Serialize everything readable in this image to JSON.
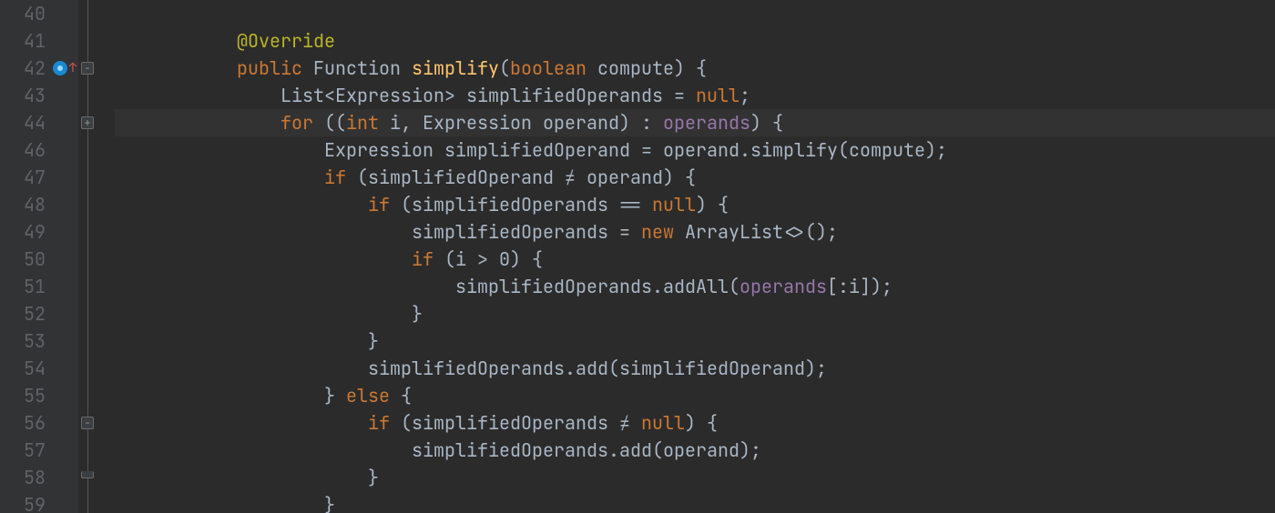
{
  "colors": {
    "background": "#2b2b2b",
    "gutter": "#313335",
    "lineNumber": "#606366",
    "foreground": "#a9b7c6",
    "annotation": "#bbb529",
    "keyword": "#cc7832",
    "method": "#ffc66d",
    "field": "#9876aa",
    "highlightedLine": "#323232"
  },
  "lineNumbers": [
    "40",
    "41",
    "42",
    "43",
    "44",
    "46",
    "47",
    "48",
    "49",
    "50",
    "51",
    "52",
    "53",
    "54",
    "55",
    "56",
    "57",
    "58",
    "59"
  ],
  "highlightedIndex": 4,
  "gutterIcons": {
    "2": "implements-marker"
  },
  "foldIcons": [
    {
      "row": 2,
      "type": "collapse"
    },
    {
      "row": 4,
      "type": "expand"
    },
    {
      "row": 15,
      "type": "collapse"
    },
    {
      "row": 17,
      "type": "end"
    }
  ],
  "code": [
    [],
    [
      {
        "t": "        ",
        "c": "tok-plain"
      },
      {
        "t": "@Override",
        "c": "tok-ann"
      }
    ],
    [
      {
        "t": "        ",
        "c": "tok-plain"
      },
      {
        "t": "public ",
        "c": "tok-kw"
      },
      {
        "t": "Function ",
        "c": "tok-type"
      },
      {
        "t": "simplify",
        "c": "tok-method"
      },
      {
        "t": "(",
        "c": "tok-plain"
      },
      {
        "t": "boolean ",
        "c": "tok-kw"
      },
      {
        "t": "compute",
        "c": "tok-plain"
      },
      {
        "t": ") {",
        "c": "tok-plain"
      }
    ],
    [
      {
        "t": "            ",
        "c": "tok-plain"
      },
      {
        "t": "List<Expression> simplifiedOperands = ",
        "c": "tok-plain"
      },
      {
        "t": "null",
        "c": "tok-kw"
      },
      {
        "t": ";",
        "c": "tok-plain"
      }
    ],
    [
      {
        "t": "            ",
        "c": "tok-plain"
      },
      {
        "t": "for ",
        "c": "tok-kw"
      },
      {
        "t": "((",
        "c": "tok-plain"
      },
      {
        "t": "int ",
        "c": "tok-kw"
      },
      {
        "t": "i",
        "c": "tok-plain"
      },
      {
        "t": ", ",
        "c": "tok-plain"
      },
      {
        "t": "Expression operand",
        "c": "tok-plain"
      },
      {
        "t": ") : ",
        "c": "tok-plain"
      },
      {
        "t": "operands",
        "c": "tok-field"
      },
      {
        "t": ") {",
        "c": "tok-plain"
      }
    ],
    [
      {
        "t": "                ",
        "c": "tok-plain"
      },
      {
        "t": "Expression simplifiedOperand = operand.simplify(compute);",
        "c": "tok-plain"
      }
    ],
    [
      {
        "t": "                ",
        "c": "tok-plain"
      },
      {
        "t": "if ",
        "c": "tok-kw"
      },
      {
        "t": "(simplifiedOperand ",
        "c": "tok-plain"
      },
      {
        "t": "≠",
        "c": "tok-lig"
      },
      {
        "t": " operand) {",
        "c": "tok-plain"
      }
    ],
    [
      {
        "t": "                    ",
        "c": "tok-plain"
      },
      {
        "t": "if ",
        "c": "tok-kw"
      },
      {
        "t": "(simplifiedOperands ",
        "c": "tok-plain"
      },
      {
        "t": "==",
        "c": "tok-lig"
      },
      {
        "t": " ",
        "c": "tok-plain"
      },
      {
        "t": "null",
        "c": "tok-kw"
      },
      {
        "t": ") {",
        "c": "tok-plain"
      }
    ],
    [
      {
        "t": "                        ",
        "c": "tok-plain"
      },
      {
        "t": "simplifiedOperands = ",
        "c": "tok-plain"
      },
      {
        "t": "new ",
        "c": "tok-kw"
      },
      {
        "t": "ArrayList",
        "c": "tok-plain"
      },
      {
        "t": "<>",
        "c": "tok-lig"
      },
      {
        "t": "();",
        "c": "tok-plain"
      }
    ],
    [
      {
        "t": "                        ",
        "c": "tok-plain"
      },
      {
        "t": "if ",
        "c": "tok-kw"
      },
      {
        "t": "(i > ",
        "c": "tok-plain"
      },
      {
        "t": "0",
        "c": "tok-plain"
      },
      {
        "t": ") {",
        "c": "tok-plain"
      }
    ],
    [
      {
        "t": "                            ",
        "c": "tok-plain"
      },
      {
        "t": "simplifiedOperands.addAll(",
        "c": "tok-plain"
      },
      {
        "t": "operands",
        "c": "tok-field"
      },
      {
        "t": "[:i]);",
        "c": "tok-plain"
      }
    ],
    [
      {
        "t": "                        ",
        "c": "tok-plain"
      },
      {
        "t": "}",
        "c": "tok-plain"
      }
    ],
    [
      {
        "t": "                    ",
        "c": "tok-plain"
      },
      {
        "t": "}",
        "c": "tok-plain"
      }
    ],
    [
      {
        "t": "                    ",
        "c": "tok-plain"
      },
      {
        "t": "simplifiedOperands.add(simplifiedOperand);",
        "c": "tok-plain"
      }
    ],
    [
      {
        "t": "                ",
        "c": "tok-plain"
      },
      {
        "t": "} ",
        "c": "tok-plain"
      },
      {
        "t": "else ",
        "c": "tok-kw"
      },
      {
        "t": "{",
        "c": "tok-plain"
      }
    ],
    [
      {
        "t": "                    ",
        "c": "tok-plain"
      },
      {
        "t": "if ",
        "c": "tok-kw"
      },
      {
        "t": "(simplifiedOperands ",
        "c": "tok-plain"
      },
      {
        "t": "≠",
        "c": "tok-lig"
      },
      {
        "t": " ",
        "c": "tok-plain"
      },
      {
        "t": "null",
        "c": "tok-kw"
      },
      {
        "t": ") {",
        "c": "tok-plain"
      }
    ],
    [
      {
        "t": "                        ",
        "c": "tok-plain"
      },
      {
        "t": "simplifiedOperands.add(operand);",
        "c": "tok-plain"
      }
    ],
    [
      {
        "t": "                    ",
        "c": "tok-plain"
      },
      {
        "t": "}",
        "c": "tok-plain"
      }
    ],
    [
      {
        "t": "                ",
        "c": "tok-plain"
      },
      {
        "t": "}",
        "c": "tok-plain"
      }
    ]
  ]
}
